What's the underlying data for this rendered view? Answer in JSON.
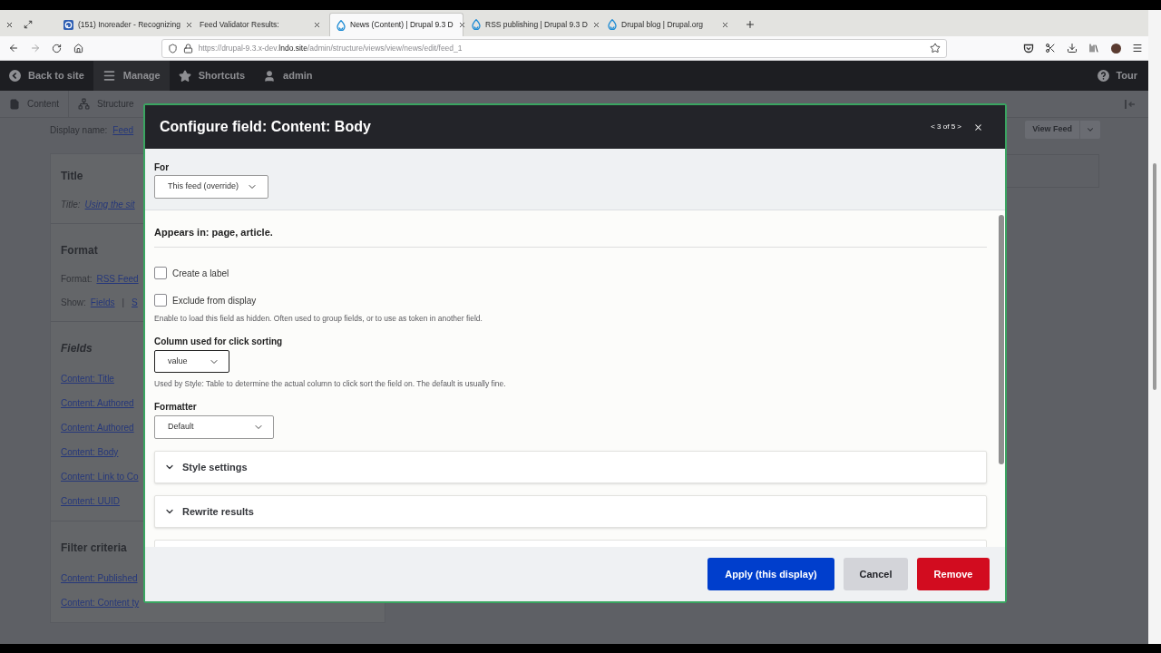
{
  "browser": {
    "tabs": [
      {
        "title": "(151) Inoreader - Recognizing",
        "kind": "feed",
        "selected": false
      },
      {
        "title": "Feed Validator Results:",
        "kind": "plain",
        "selected": false
      },
      {
        "title": "News (Content) | Drupal 9.3 D",
        "kind": "drupal",
        "selected": true
      },
      {
        "title": "RSS publishing | Drupal 9.3 D",
        "kind": "drupal",
        "selected": false
      },
      {
        "title": "Drupal blog | Drupal.org",
        "kind": "drupal",
        "selected": false
      }
    ],
    "url": {
      "start": "https://drupal-9.3.x-dev.",
      "domain": "lndo.site",
      "path": "/admin/structure/views/view/news/edit/feed_1"
    }
  },
  "drupal_toolbar": {
    "items": [
      {
        "label": "Back to site",
        "kind": "back",
        "selected": false
      },
      {
        "label": "Manage",
        "kind": "manage",
        "selected": true
      },
      {
        "label": "Shortcuts",
        "kind": "shortcuts",
        "selected": false
      },
      {
        "label": "admin",
        "kind": "user",
        "selected": false
      }
    ],
    "tour": "Tour"
  },
  "admin_menu": [
    {
      "label": "Content",
      "kind": "file"
    },
    {
      "label": "Structure",
      "kind": "structure"
    }
  ],
  "page": {
    "display_name": {
      "label": "Display name:",
      "value": "Feed"
    },
    "view_button": "View Feed",
    "sections": [
      {
        "title": "Title",
        "italic": false,
        "rows": [
          {
            "label": "Title:",
            "italic": true,
            "links": [
              "Using the sit"
            ]
          }
        ]
      },
      {
        "title": "Format",
        "italic": false,
        "rows": [
          {
            "label": "Format:",
            "italic": false,
            "links": [
              "RSS Feed"
            ]
          },
          {
            "label": "Show:",
            "italic": false,
            "links": [
              "Fields",
              "S"
            ],
            "separator": "|"
          }
        ]
      },
      {
        "title": "Fields",
        "italic": true,
        "links": [
          "Content: Title",
          "Content: Authored",
          "Content: Authored",
          "Content: Body",
          "Content: Link to Co",
          "Content: UUID"
        ]
      },
      {
        "title": "Filter criteria",
        "italic": false,
        "links": [
          "Content: Published",
          "Content: Content ty"
        ]
      }
    ]
  },
  "dialog": {
    "title": "Configure field: Content: Body",
    "pager": "< 3 of 5 >",
    "for": {
      "label": "For",
      "value": "This feed (override)"
    },
    "appears_in": "Appears in: page, article.",
    "checkboxes": [
      {
        "label": "Create a label",
        "checked": false
      },
      {
        "label": "Exclude from display",
        "checked": false
      }
    ],
    "exclude_help": "Enable to load this field as hidden. Often used to group fields, or to use as token in another field.",
    "click_sort": {
      "label": "Column used for click sorting",
      "value": "value",
      "focused": true,
      "help": "Used by Style: Table to determine the actual column to click sort the field on. The default is usually fine."
    },
    "formatter": {
      "label": "Formatter",
      "value": "Default"
    },
    "details": [
      {
        "label": "Style settings",
        "expanded": false
      },
      {
        "label": "Rewrite results",
        "expanded": false
      }
    ],
    "buttons": [
      {
        "label": "Apply (this display)",
        "kind": "primary"
      },
      {
        "label": "Cancel",
        "kind": "secondary"
      },
      {
        "label": "Remove",
        "kind": "danger"
      }
    ]
  }
}
